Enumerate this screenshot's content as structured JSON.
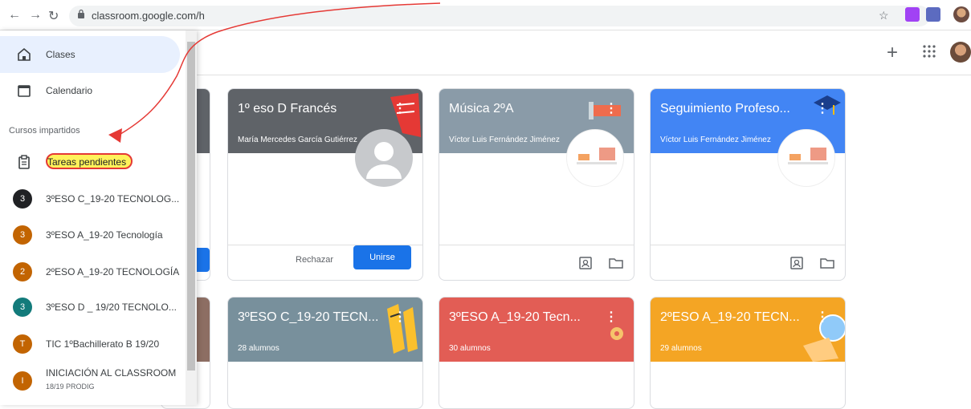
{
  "browser": {
    "url": "classroom.google.com/h"
  },
  "sidebar": {
    "items": [
      {
        "label": "Clases"
      },
      {
        "label": "Calendario"
      }
    ],
    "section_title": "Cursos impartidos",
    "pending": "Tareas pendientes",
    "courses": [
      {
        "initial": "3",
        "name": "3ºESO C_19-20 TECNOLOG...",
        "color": "#202124"
      },
      {
        "initial": "3",
        "name": "3ºESO A_19-20 Tecnología",
        "color": "#c26401"
      },
      {
        "initial": "2",
        "name": "2ºESO A_19-20 TECNOLOGÍA",
        "color": "#c26401"
      },
      {
        "initial": "3",
        "name": "3ºESO D _ 19/20 TECNOLO...",
        "color": "#137b7b"
      },
      {
        "initial": "T",
        "name": "TIC 1ºBachillerato B 19/20",
        "color": "#c26401"
      },
      {
        "initial": "I",
        "name": "INICIACIÓN AL CLASSROOM",
        "sub": "18/19 PRODIG",
        "color": "#c26401"
      }
    ]
  },
  "topbar": {
    "plus": "+",
    "apps": "⋮⋮⋮"
  },
  "cards": [
    {
      "title": "1º eso D Francés",
      "sub": "María Mercedes García Gutiérrez",
      "color": "#5f6368",
      "reject": "Rechazar",
      "join": "Unirse"
    },
    {
      "title": "Música 2ºA",
      "sub": "Víctor Luis Fernández Jiménez",
      "color": "#8a9ba8"
    },
    {
      "title": "Seguimiento Profeso...",
      "sub": "Víctor Luis Fernández Jiménez",
      "color": "#4285f4"
    },
    {
      "title": "3ºESO C_19-20 TECN...",
      "sub": "28 alumnos",
      "color": "#78909c"
    },
    {
      "title": "3ºESO A_19-20 Tecn...",
      "sub": "30 alumnos",
      "color": "#e25d55"
    },
    {
      "title": "2ºESO A_19-20 TECN...",
      "sub": "29 alumnos",
      "color": "#f4a524"
    }
  ]
}
